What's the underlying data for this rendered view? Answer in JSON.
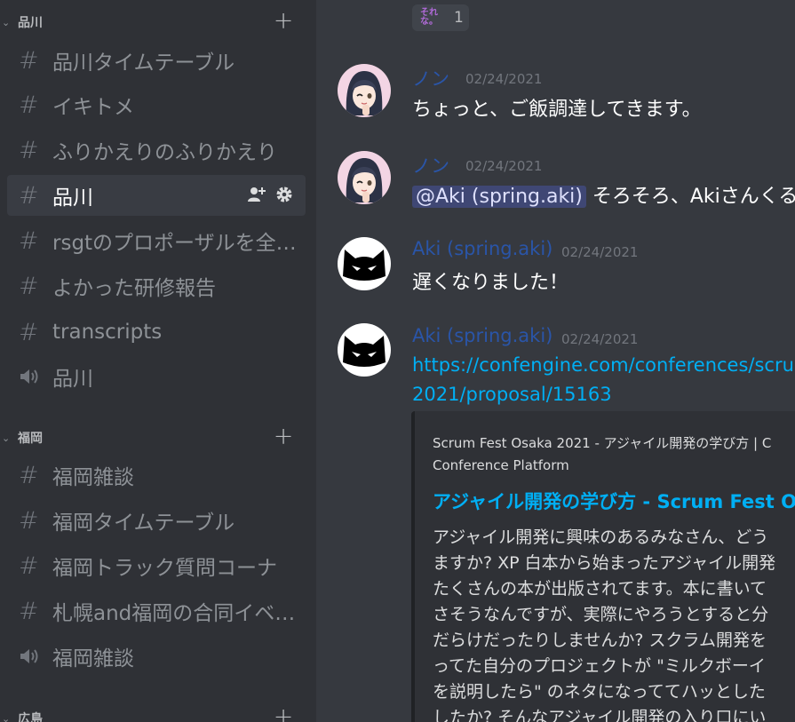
{
  "sidebar": {
    "categories": [
      {
        "label": "品川",
        "channels": [
          {
            "name": "品川タイムテーブル",
            "type": "text"
          },
          {
            "name": "イキトメ",
            "type": "text"
          },
          {
            "name": "ふりかえりのふりかえり",
            "type": "text"
          },
          {
            "name": "品川",
            "type": "text",
            "selected": true
          },
          {
            "name": "rsgtのプロポーザルを全…",
            "type": "text"
          },
          {
            "name": "よかった研修報告",
            "type": "text"
          },
          {
            "name": "transcripts",
            "type": "text"
          },
          {
            "name": "品川",
            "type": "voice"
          }
        ]
      },
      {
        "label": "福岡",
        "channels": [
          {
            "name": "福岡雑談",
            "type": "text"
          },
          {
            "name": "福岡タイムテーブル",
            "type": "text"
          },
          {
            "name": "福岡トラック質問コーナ",
            "type": "text"
          },
          {
            "name": "札幌and福岡の合同イベ…",
            "type": "text"
          },
          {
            "name": "福岡雑談",
            "type": "voice"
          }
        ]
      },
      {
        "label": "広島",
        "channels": []
      }
    ]
  },
  "reaction": {
    "emoji_text": "それな。",
    "count": "1"
  },
  "messages": [
    {
      "author": "ノン",
      "timestamp": "02/24/2021",
      "text": "ちょっと、ご飯調達してきます。"
    },
    {
      "author": "ノン",
      "timestamp": "02/24/2021",
      "mention": "@Aki (spring.aki)",
      "text": " そろそろ、Akiさんくる"
    },
    {
      "author": "Aki (spring.aki)",
      "timestamp": "02/24/2021",
      "text": "遅くなりました！"
    },
    {
      "author": "Aki (spring.aki)",
      "timestamp": "02/24/2021",
      "link_lines": [
        "https://confengine.com/conferences/scru",
        "2021/proposal/15163"
      ],
      "embed": {
        "provider_lines": [
          "Scrum Fest Osaka 2021 - アジャイル開発の学び方 | C",
          "Conference Platform"
        ],
        "title": "アジャイル開発の学び方 - Scrum Fest O",
        "description_lines": [
          "アジャイル開発に興味のあるみなさん、どう",
          "ますか? XP 白本から始まったアジャイル開発",
          "たくさんの本が出版されてます。本に書いて",
          "さそうなんですが、実際にやろうとすると分",
          "だらけだったりしませんか? スクラム開発を",
          "ってた自分のプロジェクトが \"ミルクボーイ",
          "を説明したら\" のネタになっててハッとした",
          "したか? そんなアジャイル開発の入り口にい"
        ]
      }
    }
  ],
  "colors": {
    "sidebar_bg": "#2f3136",
    "chat_bg": "#36393f",
    "link": "#00aff4",
    "username_blue": "#2a55a8"
  }
}
